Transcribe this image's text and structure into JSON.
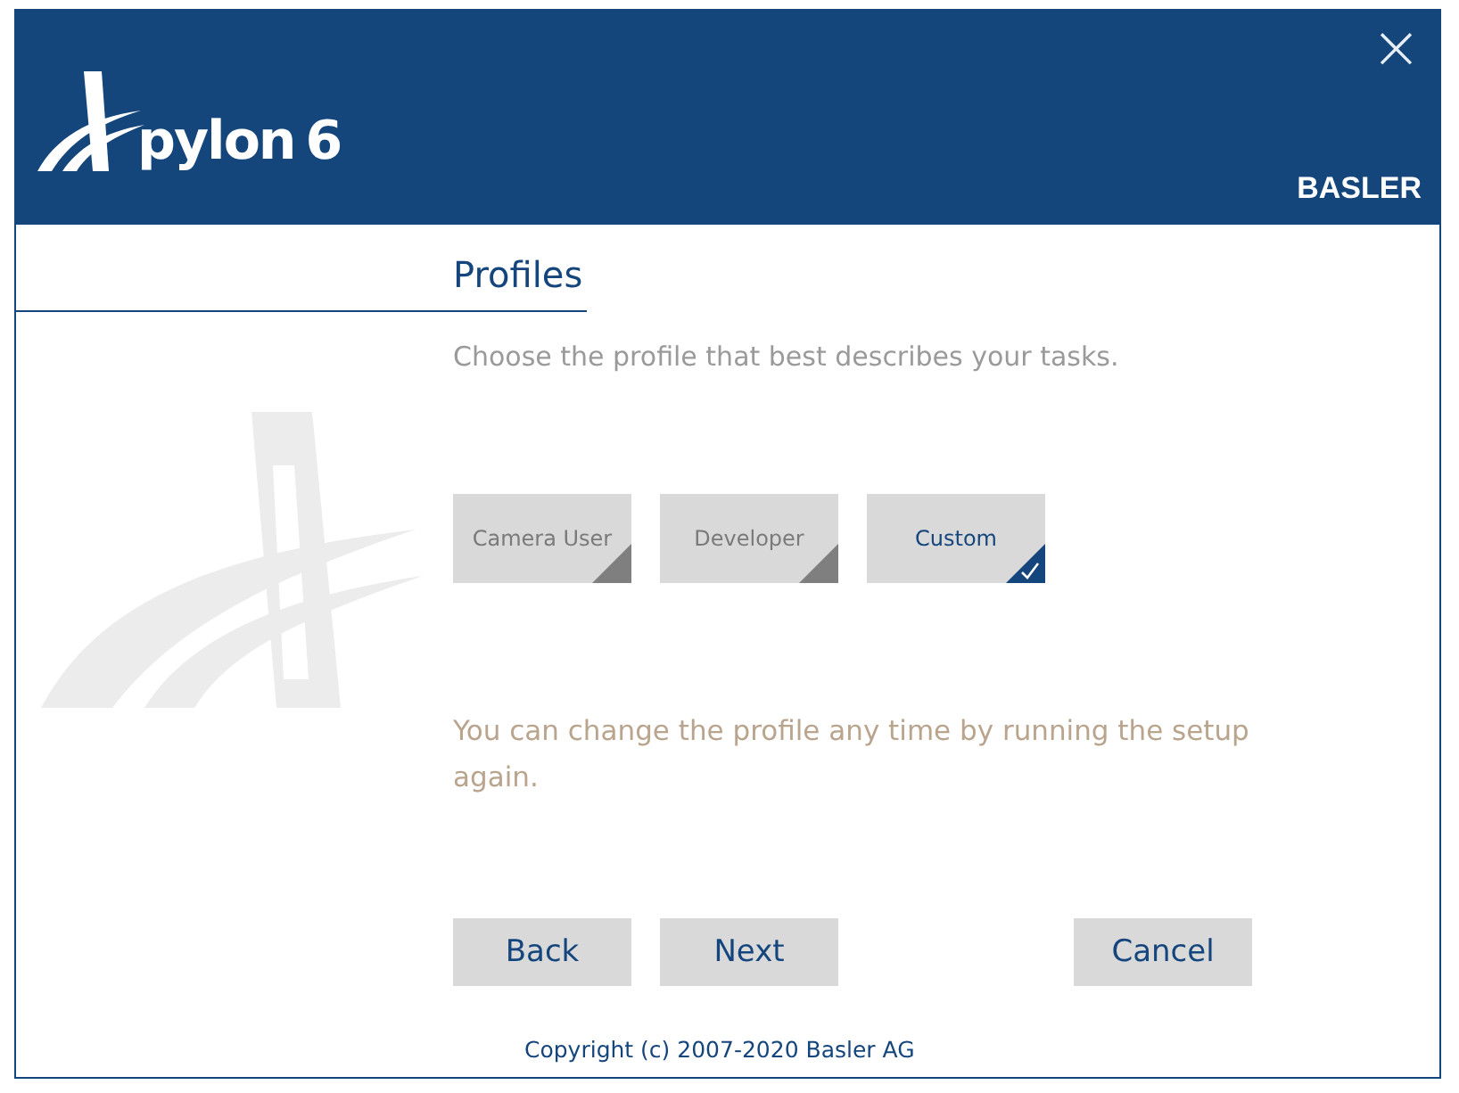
{
  "header": {
    "product": "pylon",
    "version": "6",
    "brand": "BASLER",
    "close": "×"
  },
  "title": "Profiles",
  "instruction": "Choose the profile that best describes your tasks.",
  "profiles": [
    {
      "label": "Camera User",
      "selected": false
    },
    {
      "label": "Developer",
      "selected": false
    },
    {
      "label": "Custom",
      "selected": true
    }
  ],
  "note": "You can change the profile any time by running the setup again.",
  "buttons": {
    "back": "Back",
    "next": "Next",
    "cancel": "Cancel"
  },
  "copyright": "Copyright (c) 2007-2020 Basler AG"
}
